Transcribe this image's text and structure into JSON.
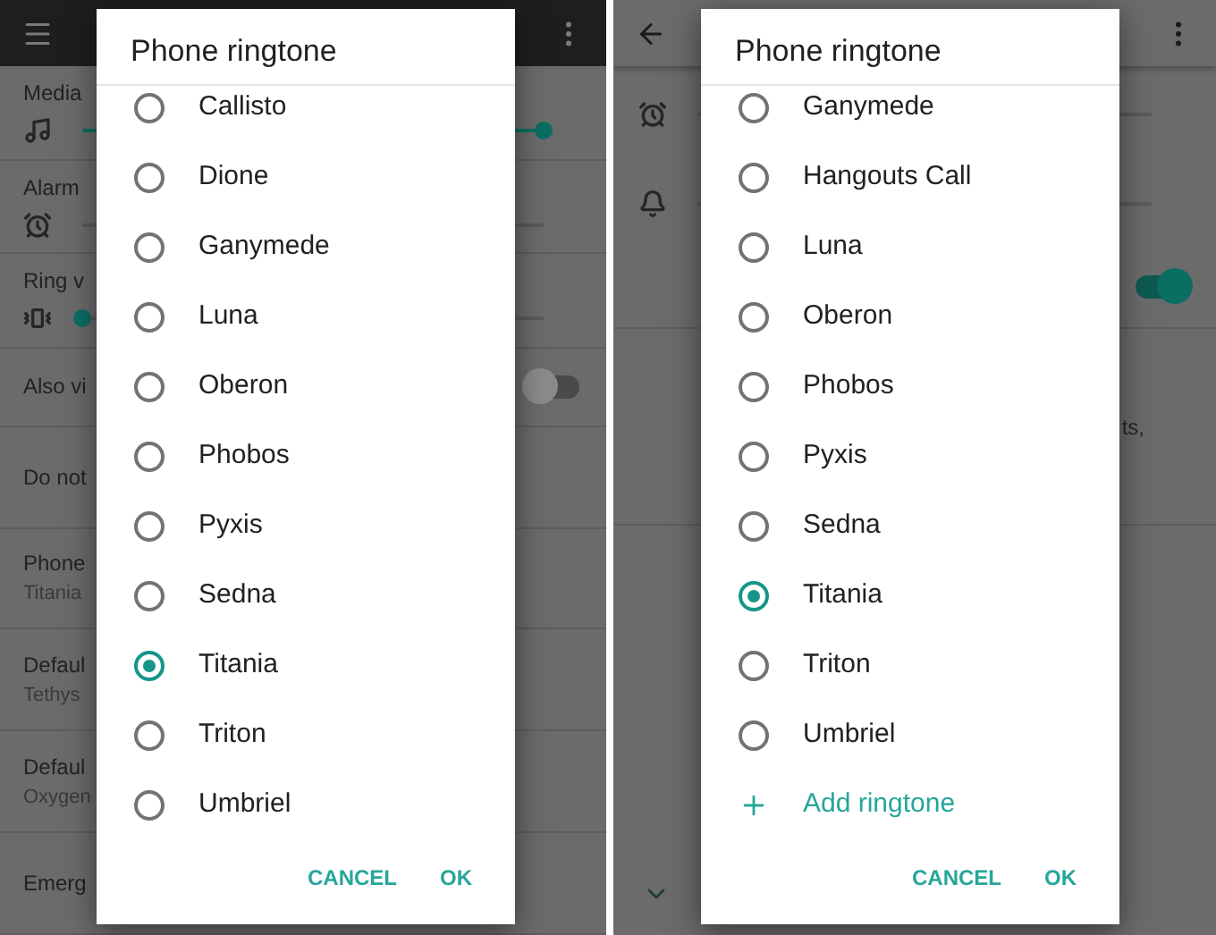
{
  "screens": [
    {
      "top_bar": {
        "kind": "menu",
        "dark": true
      },
      "rows": [
        {
          "kind": "slider",
          "label": "Media",
          "level": 1
        },
        {
          "kind": "slider",
          "label": "Alarm"
        },
        {
          "kind": "slider",
          "label": "Ring v",
          "level": 0
        },
        {
          "kind": "toggle",
          "label": "Also vi",
          "on": false
        },
        {
          "kind": "text",
          "label": "Do not"
        },
        {
          "kind": "text",
          "label": "Phone",
          "summary": "Titania"
        },
        {
          "kind": "text",
          "label": "Defaul",
          "summary": "Tethys"
        },
        {
          "kind": "text",
          "label": "Defaul",
          "summary": "Oxygen"
        },
        {
          "kind": "text",
          "label": "Emerg"
        }
      ],
      "dialog": {
        "title": "Phone ringtone",
        "options": [
          {
            "label": "Callisto",
            "selected": false
          },
          {
            "label": "Dione",
            "selected": false
          },
          {
            "label": "Ganymede",
            "selected": false
          },
          {
            "label": "Luna",
            "selected": false
          },
          {
            "label": "Oberon",
            "selected": false
          },
          {
            "label": "Phobos",
            "selected": false
          },
          {
            "label": "Pyxis",
            "selected": false
          },
          {
            "label": "Sedna",
            "selected": false
          },
          {
            "label": "Titania",
            "selected": true
          },
          {
            "label": "Triton",
            "selected": false
          },
          {
            "label": "Umbriel",
            "selected": false
          }
        ],
        "buttons": [
          "CANCEL",
          "OK"
        ]
      }
    },
    {
      "top_bar": {
        "kind": "back",
        "dark": false
      },
      "rows": [
        {
          "kind": "slider"
        },
        {
          "kind": "slider"
        },
        {
          "kind": "toggle",
          "on": true
        },
        {
          "kind": "text",
          "summary_right": "ts,"
        }
      ],
      "footer_chevron": true,
      "dialog": {
        "title": "Phone ringtone",
        "options": [
          {
            "label": "Ganymede",
            "selected": false
          },
          {
            "label": "Hangouts Call",
            "selected": false
          },
          {
            "label": "Luna",
            "selected": false
          },
          {
            "label": "Oberon",
            "selected": false
          },
          {
            "label": "Phobos",
            "selected": false
          },
          {
            "label": "Pyxis",
            "selected": false
          },
          {
            "label": "Sedna",
            "selected": false
          },
          {
            "label": "Titania",
            "selected": true
          },
          {
            "label": "Triton",
            "selected": false
          },
          {
            "label": "Umbriel",
            "selected": false
          }
        ],
        "action": "Add ringtone",
        "buttons": [
          "CANCEL",
          "OK"
        ]
      }
    }
  ]
}
